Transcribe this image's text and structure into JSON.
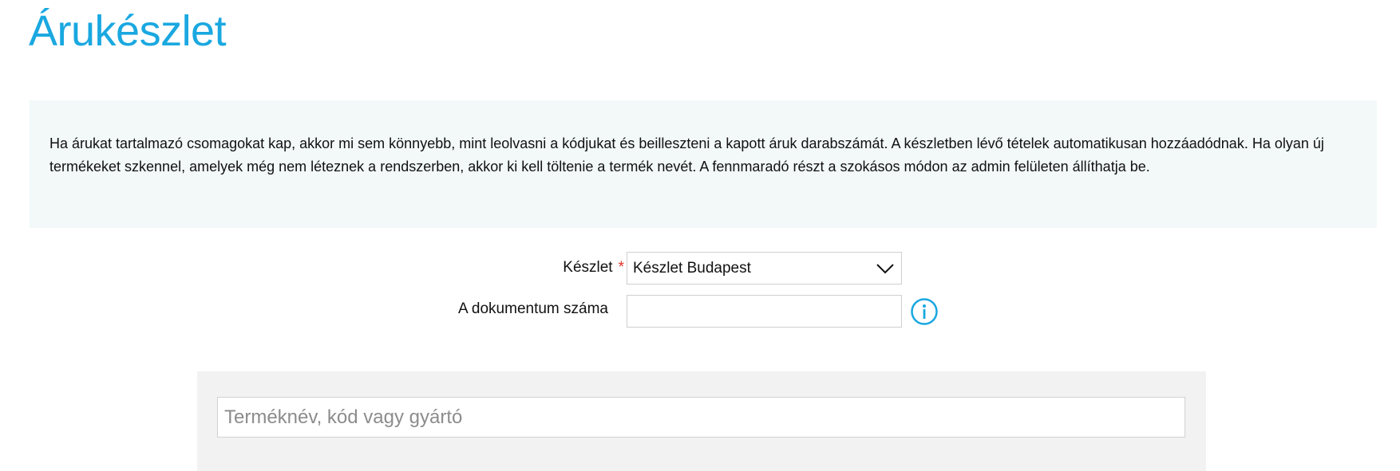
{
  "page": {
    "title": "Árukészlet"
  },
  "info": {
    "text": "Ha árukat tartalmazó csomagokat kap, akkor mi sem könnyebb, mint leolvasni a kódjukat és beilleszteni a kapott áruk darabszámát. A készletben lévő tételek automatikusan hozzáadódnak. Ha olyan új termékeket szkennel, amelyek még nem léteznek a rendszerben, akkor ki kell töltenie a termék nevét. A fennmaradó részt a szokásos módon az admin felületen állíthatja be."
  },
  "form": {
    "stock_label": "Készlet",
    "required_marker": "*",
    "stock_selected": "Készlet Budapest",
    "document_label": "A dokumentum száma",
    "document_value": ""
  },
  "search": {
    "placeholder": "Terméknév, kód vagy gyártó"
  },
  "colors": {
    "title": "#1aa8e0",
    "info_background": "#f2f9f8",
    "required": "#e0312a",
    "info_icon": "#1aa8e0",
    "search_panel": "#f2f2f2"
  },
  "icons": {
    "select": "chevron-down-icon",
    "document_help": "info-icon"
  }
}
